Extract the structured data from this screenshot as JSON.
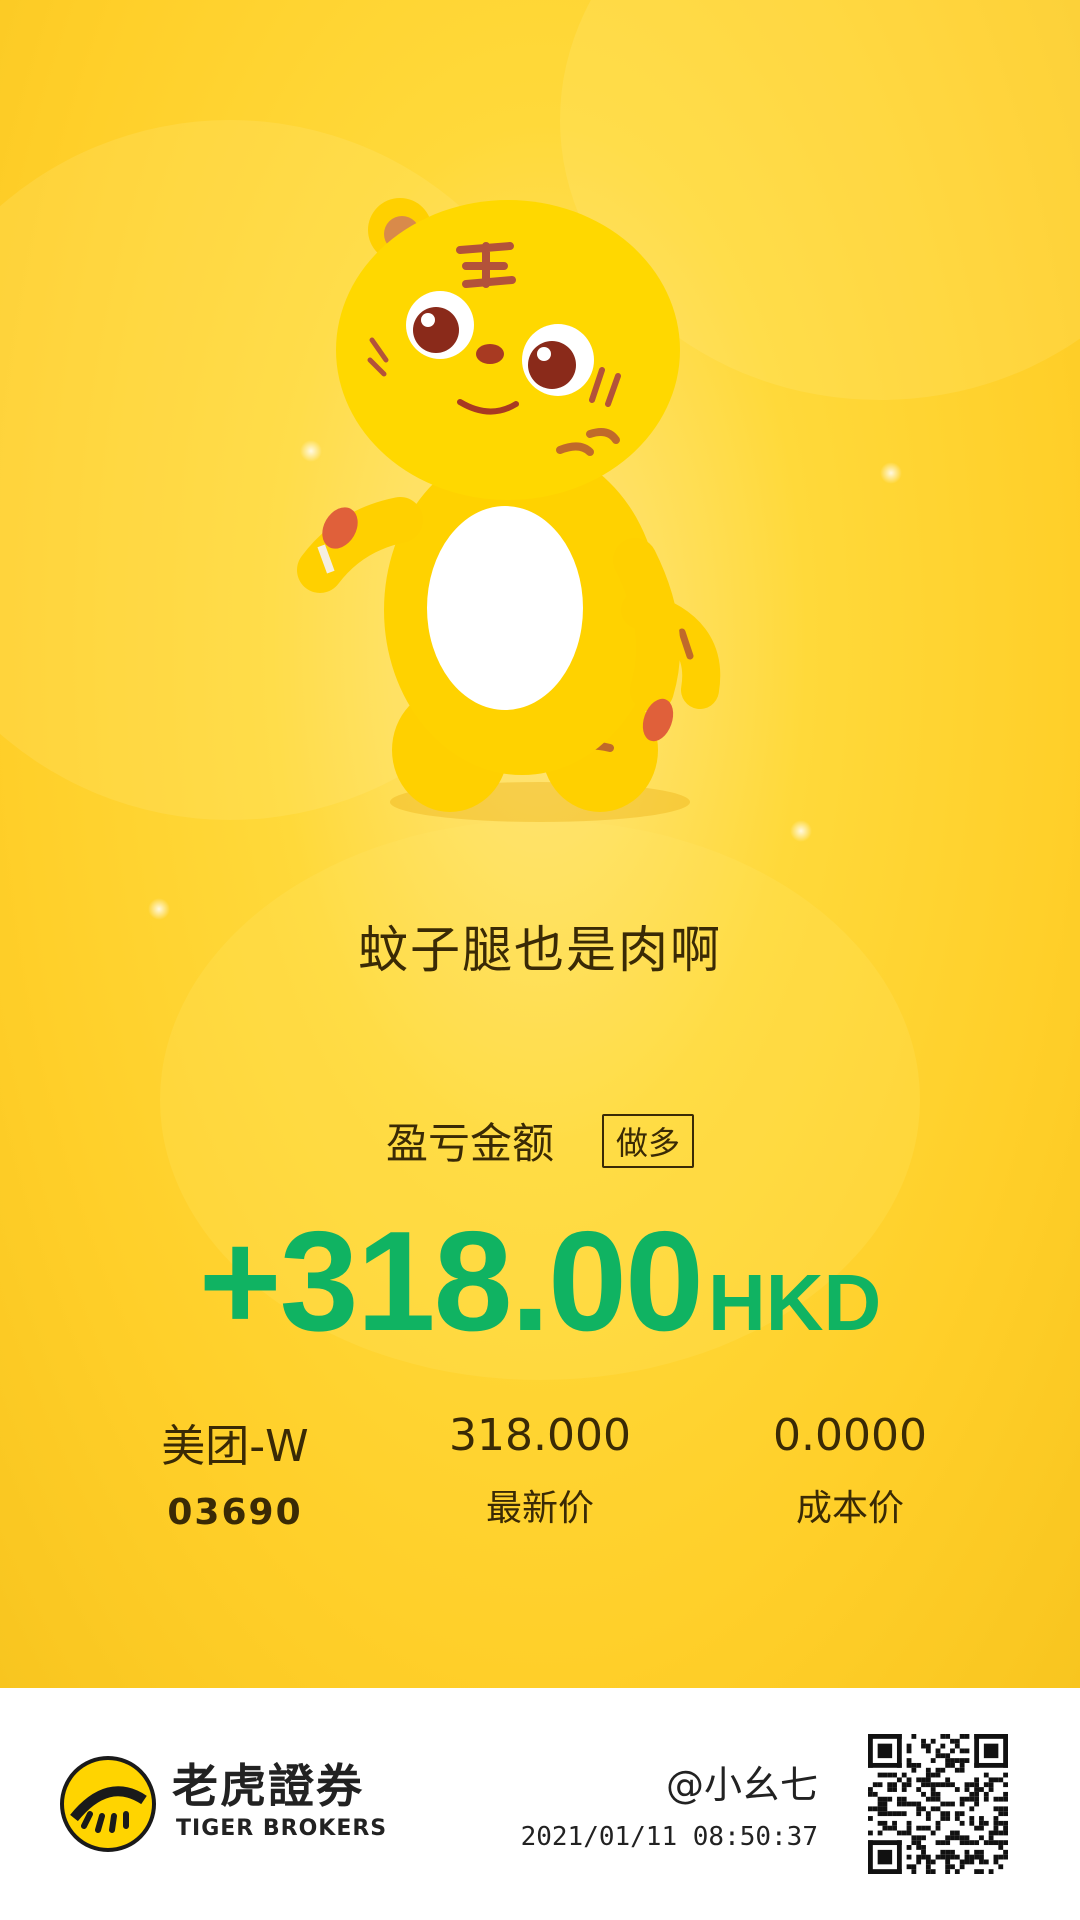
{
  "slogan": "蚊子腿也是肉啊",
  "pnl": {
    "label": "盈亏金额",
    "direction_tag": "做多",
    "amount": "+318.00",
    "currency": "HKD",
    "amount_color": "#10b362"
  },
  "stock": {
    "name": "美团-W",
    "code": "03690"
  },
  "latest_price": {
    "value": "318.000",
    "label": "最新价"
  },
  "cost_price": {
    "value": "0.0000",
    "label": "成本价"
  },
  "footer": {
    "brand_cn": "老虎證券",
    "brand_en": "TIGER BROKERS",
    "user": "@小幺七",
    "timestamp": "2021/01/11 08:50:37",
    "qr_icon": "qr-code-icon"
  },
  "colors": {
    "background": "#ffd93a",
    "text": "#3a2a05",
    "profit": "#10b362"
  }
}
